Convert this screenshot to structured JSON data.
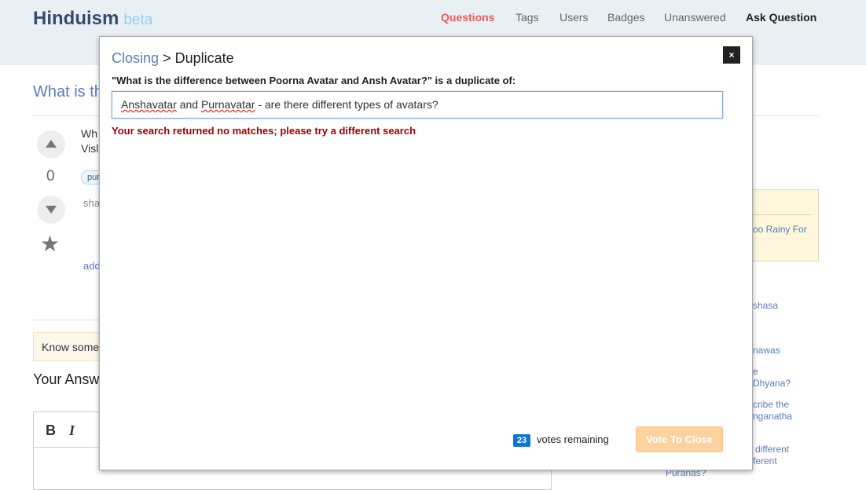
{
  "site": {
    "name": "Hinduism",
    "badge": "beta"
  },
  "nav": {
    "questions": "Questions",
    "tags": "Tags",
    "users": "Users",
    "badges": "Badges",
    "unanswered": "Unanswered",
    "ask": "Ask Question"
  },
  "background": {
    "title_fragment": "What is th",
    "body_line1": "Wh",
    "body_line2": "Visl",
    "vote_count": "0",
    "tag_fragment": "pur",
    "share_fragment": "sha",
    "add_fragment": "add",
    "know_fragment": "Know some",
    "your_answer_fragment": "Your Answ",
    "editor_bold": "B",
    "editor_italic": "I",
    "sidebar_fragments": [
      "oo Rainy For",
      "shasa",
      "nawas",
      "e",
      "Dhyana?",
      "cribe the",
      "nganatha",
      "different",
      "ferent",
      "Puranas?"
    ]
  },
  "modal": {
    "breadcrumb_parent": "Closing",
    "breadcrumb_sep": ">",
    "breadcrumb_current": "Duplicate",
    "close_label": "×",
    "prompt": "\"What is the difference between Poorna Avatar and Ansh Avatar?\" is a duplicate of:",
    "search_value_parts": [
      "Anshavatar",
      " and ",
      "Purnavatar",
      " - are there different types of avatars?"
    ],
    "error": "Your search returned no matches; please try a different search",
    "votes_remaining_count": "23",
    "votes_remaining_label": "votes remaining",
    "vote_button": "Vote To Close"
  },
  "colors": {
    "accent": "#5a7cbf",
    "error": "#a00000",
    "nav_active": "#f05a5a",
    "vote_disabled": "#fcd29e",
    "badge": "#0d74d8"
  }
}
